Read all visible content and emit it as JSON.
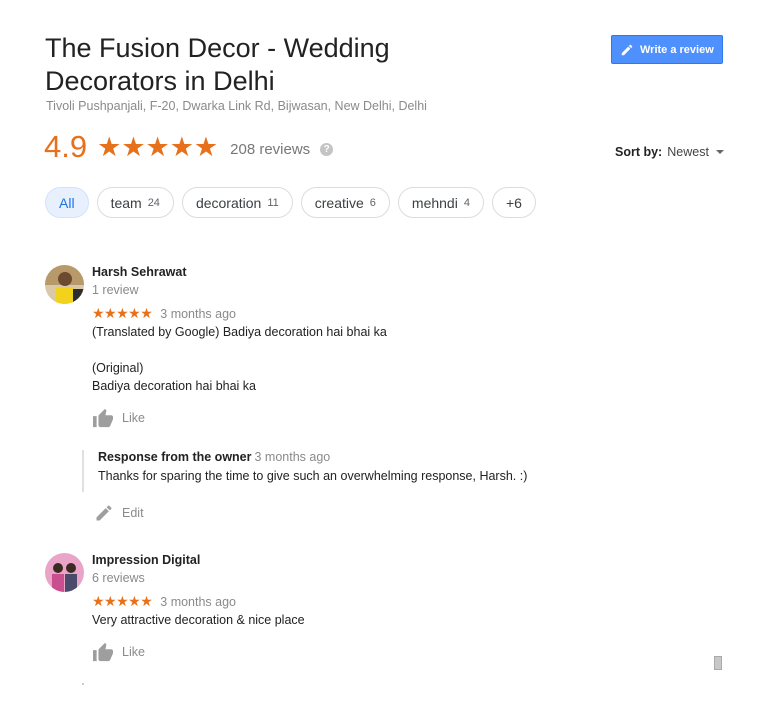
{
  "place": {
    "title": "The Fusion Decor - Wedding Decorators in Delhi",
    "address": "Tivoli Pushpanjali, F-20, Dwarka Link Rd, Bijwasan, New Delhi, Delhi",
    "rating": "4.9",
    "stars": "★★★★★",
    "reviews_count": "208 reviews",
    "help_icon": "?"
  },
  "write_review": {
    "label": "Write a review",
    "icon": "pencil-icon"
  },
  "sort": {
    "label": "Sort by:",
    "value": "Newest"
  },
  "chips": [
    {
      "label": "All",
      "count": ""
    },
    {
      "label": "team",
      "count": "24"
    },
    {
      "label": "decoration",
      "count": "11"
    },
    {
      "label": "creative",
      "count": "6"
    },
    {
      "label": "mehndi",
      "count": "4"
    },
    {
      "label": "+6",
      "count": ""
    }
  ],
  "reviews": [
    {
      "name": "Harsh Sehrawat",
      "sub": "1 review",
      "stars": "★★★★★",
      "time": "3 months ago",
      "translated": "(Translated by Google) Badiya decoration hai bhai ka",
      "original_label": "(Original)",
      "original": "Badiya decoration hai bhai ka",
      "like": "Like",
      "owner_response": {
        "title": "Response from the owner",
        "time": "3 months ago",
        "text": "Thanks for sparing the time to give such an overwhelming response, Harsh. :)"
      },
      "edit": "Edit"
    },
    {
      "name": "Impression Digital",
      "sub": "6 reviews",
      "stars": "★★★★★",
      "time": "3 months ago",
      "text": "Very attractive decoration & nice place",
      "like": "Like"
    }
  ],
  "colors": {
    "accent_orange": "#e7711b",
    "button_blue": "#4d90fe",
    "chip_active_bg": "#e8f0fe",
    "chip_active_text": "#1a73e8"
  }
}
